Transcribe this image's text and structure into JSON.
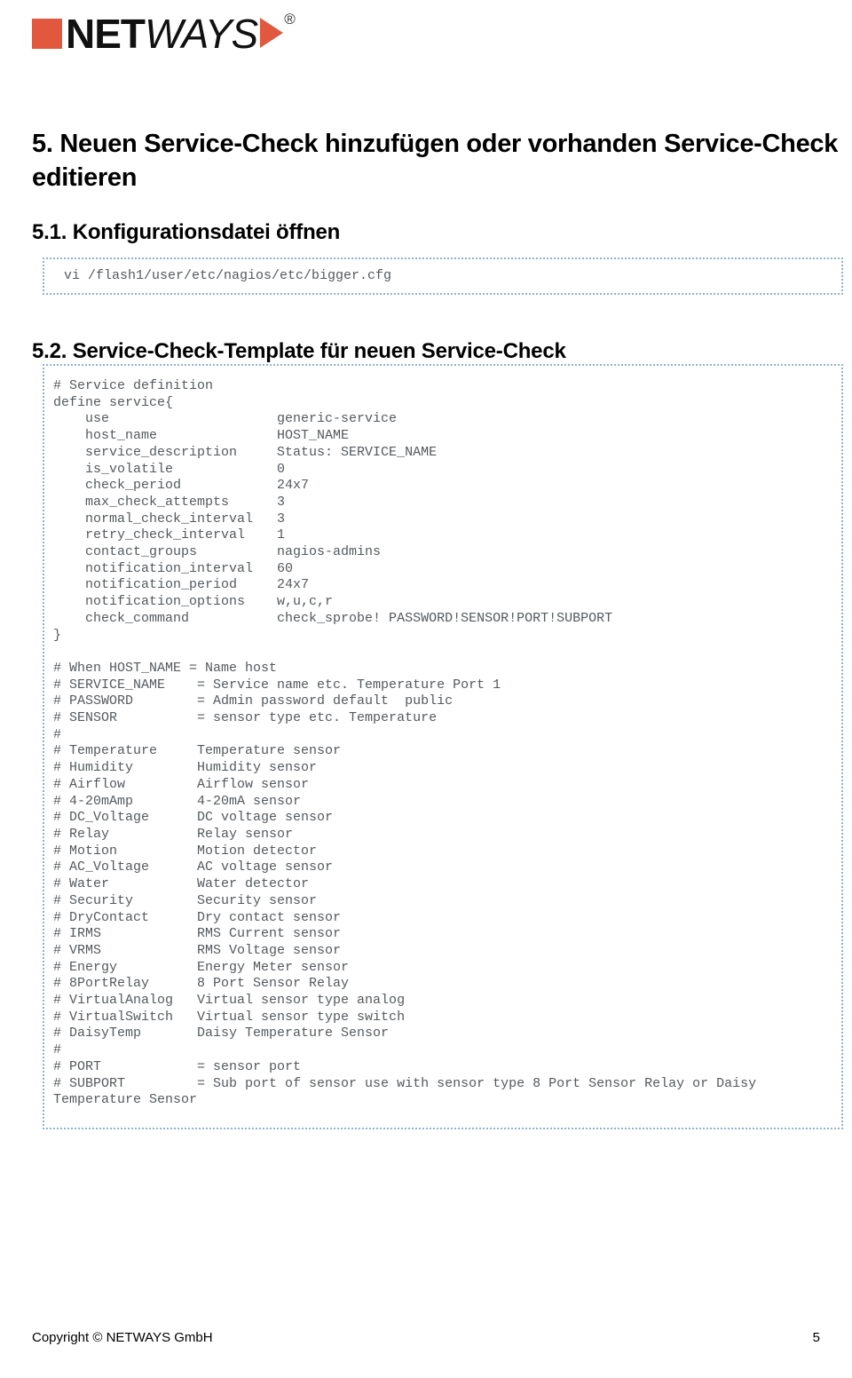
{
  "logo": {
    "name_bold": "NET",
    "name_italic": "WAYS",
    "registered_mark": "®",
    "square_color": "#e2583f",
    "triangle_color": "#e2583f"
  },
  "headings": {
    "section_5": "5. Neuen Service-Check hinzufügen oder vorhanden Service-Check editieren",
    "section_5_1": "5.1. Konfigurationsdatei öffnen",
    "section_5_2": "5.2. Service-Check-Template für neuen Service-Check"
  },
  "code_blocks": {
    "open_config_command": "vi /flash1/user/etc/nagios/etc/bigger.cfg",
    "service_template": "# Service definition\ndefine service{\n    use                     generic-service\n    host_name               HOST_NAME\n    service_description     Status: SERVICE_NAME\n    is_volatile             0\n    check_period            24x7\n    max_check_attempts      3\n    normal_check_interval   3\n    retry_check_interval    1\n    contact_groups          nagios-admins\n    notification_interval   60\n    notification_period     24x7\n    notification_options    w,u,c,r\n    check_command           check_sprobe! PASSWORD!SENSOR!PORT!SUBPORT\n}\n\n# When HOST_NAME = Name host\n# SERVICE_NAME    = Service name etc. Temperature Port 1\n# PASSWORD        = Admin password default  public\n# SENSOR          = sensor type etc. Temperature\n#\n# Temperature     Temperature sensor\n# Humidity        Humidity sensor\n# Airflow         Airflow sensor\n# 4-20mAmp        4-20mA sensor\n# DC_Voltage      DC voltage sensor\n# Relay           Relay sensor\n# Motion          Motion detector\n# AC_Voltage      AC voltage sensor\n# Water           Water detector\n# Security        Security sensor\n# DryContact      Dry contact sensor\n# IRMS            RMS Current sensor\n# VRMS            RMS Voltage sensor\n# Energy          Energy Meter sensor\n# 8PortRelay      8 Port Sensor Relay\n# VirtualAnalog   Virtual sensor type analog\n# VirtualSwitch   Virtual sensor type switch\n# DaisyTemp       Daisy Temperature Sensor\n#\n# PORT            = sensor port\n# SUBPORT         = Sub port of sensor use with sensor type 8 Port Sensor Relay or Daisy\nTemperature Sensor"
  },
  "footer": {
    "copyright": "Copyright © NETWAYS GmbH",
    "page_number": "5"
  }
}
